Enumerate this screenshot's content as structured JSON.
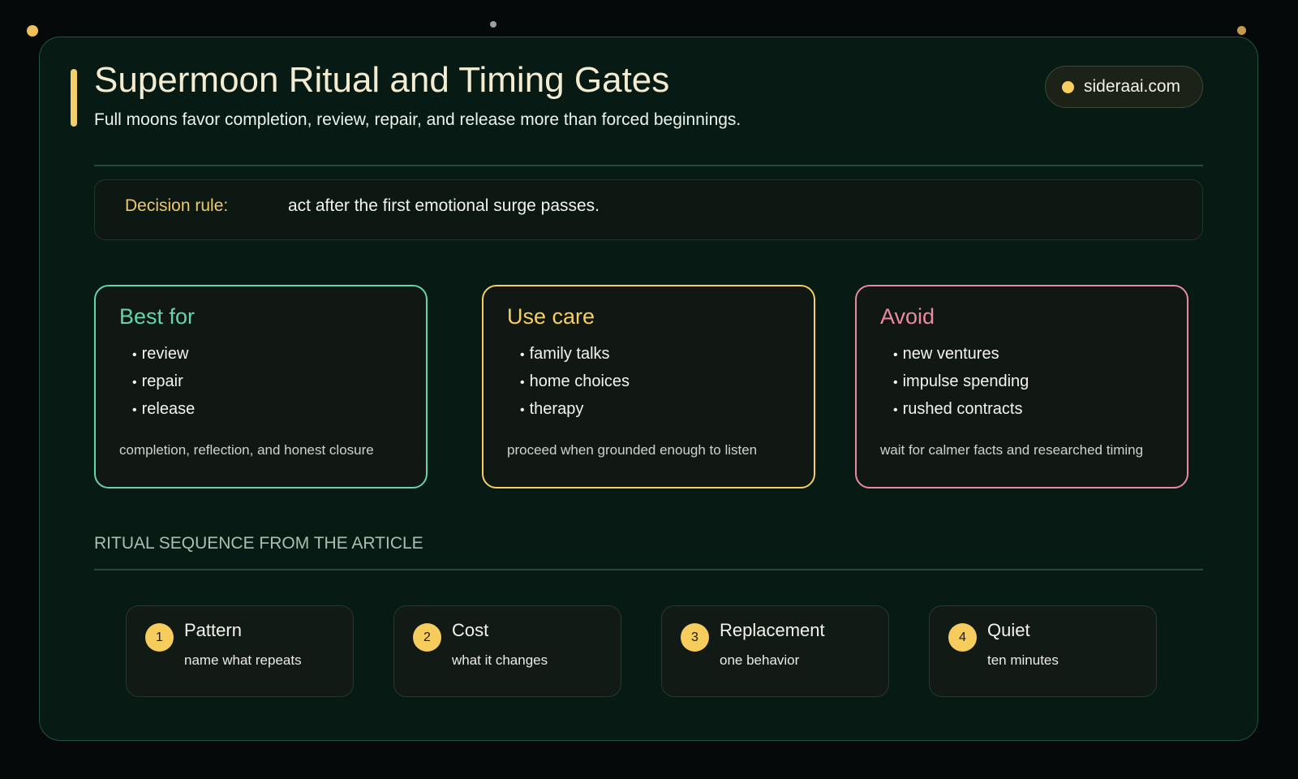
{
  "header": {
    "title": "Supermoon Ritual and Timing Gates",
    "subtitle": "Full moons favor completion, review, repair, and release more than forced beginnings.",
    "site": "sideraai.com"
  },
  "decision": {
    "label": "Decision rule:",
    "text": "act after the first emotional surge passes."
  },
  "cards": [
    {
      "title": "Best for",
      "items": [
        "review",
        "repair",
        "release"
      ],
      "note": "completion, reflection, and honest closure",
      "color": "#63d4ad"
    },
    {
      "title": "Use care",
      "items": [
        "family talks",
        "home choices",
        "therapy"
      ],
      "note": "proceed when grounded enough to listen",
      "color": "#f4cf63"
    },
    {
      "title": "Avoid",
      "items": [
        "new ventures",
        "impulse spending",
        "rushed contracts"
      ],
      "note": "wait for calmer facts and researched timing",
      "color": "#e98aa2"
    }
  ],
  "sequence": {
    "title": "RITUAL SEQUENCE FROM THE ARTICLE",
    "steps": [
      {
        "num": "1",
        "title": "Pattern",
        "sub": "name what repeats"
      },
      {
        "num": "2",
        "title": "Cost",
        "sub": "what it changes"
      },
      {
        "num": "3",
        "title": "Replacement",
        "sub": "one behavior"
      },
      {
        "num": "4",
        "title": "Quiet",
        "sub": "ten minutes"
      }
    ]
  },
  "colors": {
    "background": "#060909",
    "panel": "#071a14",
    "accent": "#f2cf6b"
  }
}
